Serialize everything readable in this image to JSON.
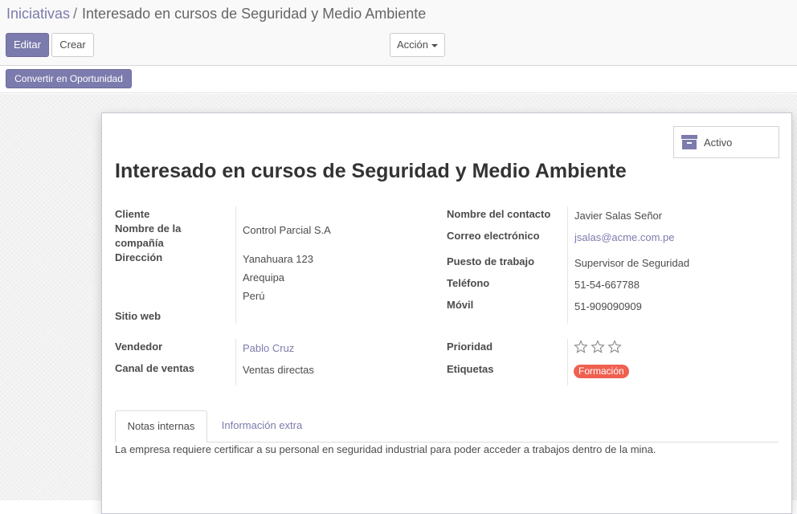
{
  "breadcrumb": {
    "parent": "Iniciativas",
    "separator": "/",
    "current": "Interesado en cursos de Seguridad y Medio Ambiente"
  },
  "toolbar": {
    "edit_label": "Editar",
    "create_label": "Crear",
    "action_label": "Acción"
  },
  "statusbar": {
    "convert_label": "Convertir en Oportunidad"
  },
  "smart_button": {
    "active_label": "Activo",
    "icon": "archive-icon"
  },
  "record": {
    "title": "Interesado en cursos de Seguridad y Medio Ambiente"
  },
  "left_fields": {
    "cliente_label": "Cliente",
    "company_label_line1": "Nombre de la",
    "company_label_line2": "compañía",
    "company_value": "Control Parcial S.A",
    "address_label": "Dirección",
    "street": "Yanahuara 123",
    "city": "Arequipa",
    "country": "Perú",
    "website_label": "Sitio web",
    "salesperson_label": "Vendedor",
    "salesperson_value": "Pablo Cruz",
    "channel_label": "Canal de ventas",
    "channel_value": "Ventas directas"
  },
  "right_fields": {
    "contact_label": "Nombre del contacto",
    "contact_value": "Javier Salas Señor",
    "email_label": "Correo electrónico",
    "email_value": "jsalas@acme.com.pe",
    "job_label": "Puesto de trabajo",
    "job_value": "Supervisor de Seguridad",
    "phone_label": "Teléfono",
    "phone_value": "51-54-667788",
    "mobile_label": "Móvil",
    "mobile_value": "51-909090909",
    "priority_label": "Prioridad",
    "priority_stars": 0,
    "priority_max": 3,
    "tags_label": "Etiquetas",
    "tag": "Formación"
  },
  "tabs": {
    "internal_notes": "Notas internas",
    "extra_info": "Información extra"
  },
  "notes": {
    "text": "La empresa requiere certificar a su personal en seguridad industrial para poder acceder a trabajos dentro de la mina."
  },
  "colors": {
    "primary": "#7c7bad",
    "tag": "#f06050"
  }
}
